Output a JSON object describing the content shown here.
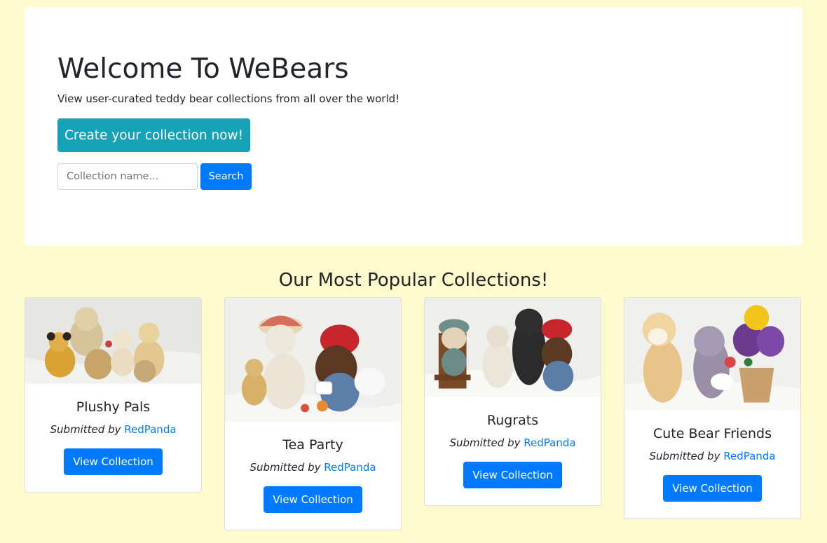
{
  "hero": {
    "title": "Welcome To WeBears",
    "subtitle": "View user-curated teddy bear collections from all over the world!",
    "create_button": "Create your collection now!",
    "search_placeholder": "Collection name...",
    "search_button": "Search"
  },
  "popular": {
    "heading": "Our Most Popular Collections!",
    "cards": [
      {
        "title": "Plushy Pals",
        "submitted_label": "Submitted by",
        "author": "RedPanda",
        "button": "View Collection"
      },
      {
        "title": "Tea Party",
        "submitted_label": "Submitted by",
        "author": "RedPanda",
        "button": "View Collection"
      },
      {
        "title": "Rugrats",
        "submitted_label": "Submitted by",
        "author": "RedPanda",
        "button": "View Collection"
      },
      {
        "title": "Cute Bear Friends",
        "submitted_label": "Submitted by",
        "author": "RedPanda",
        "button": "View Collection"
      }
    ]
  },
  "colors": {
    "page_background": "#fffacd",
    "primary": "#007bff",
    "info": "#17a2b8"
  }
}
